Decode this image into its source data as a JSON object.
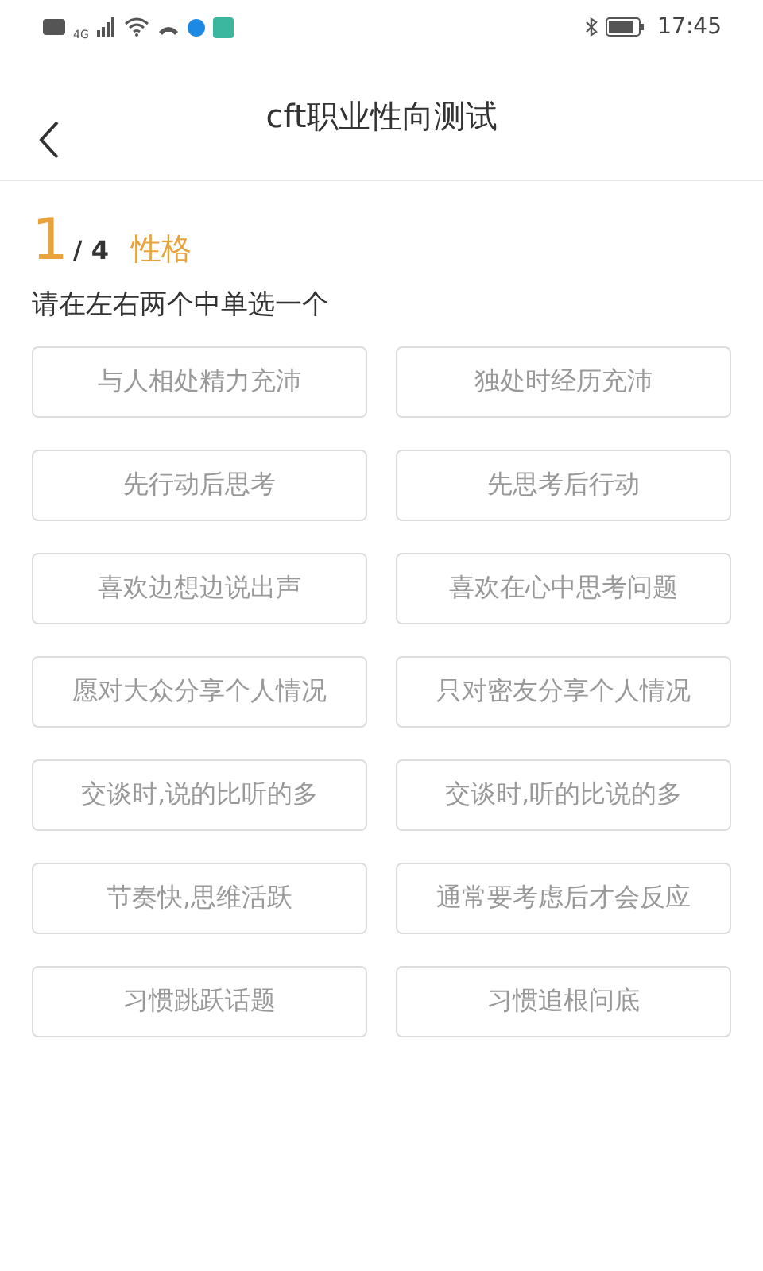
{
  "status_bar": {
    "network": "4G",
    "time": "17:45"
  },
  "header": {
    "title": "cft职业性向测试"
  },
  "progress": {
    "current": "1",
    "total": "/ 4",
    "section": "性格"
  },
  "instruction": "请在左右两个中单选一个",
  "pairs": [
    {
      "left": {
        "label": "与人相处精力充沛",
        "selected": false
      },
      "right": {
        "label": "独处时经历充沛",
        "selected": false
      }
    },
    {
      "left": {
        "label": "先行动后思考",
        "selected": false
      },
      "right": {
        "label": "先思考后行动",
        "selected": false
      }
    },
    {
      "left": {
        "label": "喜欢边想边说出声",
        "selected": false
      },
      "right": {
        "label": "喜欢在心中思考问题",
        "selected": false
      }
    },
    {
      "left": {
        "label": "愿对大众分享个人情况",
        "selected": false
      },
      "right": {
        "label": "只对密友分享个人情况",
        "selected": false
      }
    },
    {
      "left": {
        "label": "交谈时,说的比听的多",
        "selected": false
      },
      "right": {
        "label": "交谈时,听的比说的多",
        "selected": false
      }
    },
    {
      "left": {
        "label": "节奏快,思维活跃",
        "selected": false
      },
      "right": {
        "label": "通常要考虑后才会反应",
        "selected": false
      }
    },
    {
      "left": {
        "label": "习惯跳跃话题",
        "selected": false
      },
      "right": {
        "label": "习惯追根问底",
        "selected": false
      }
    }
  ]
}
